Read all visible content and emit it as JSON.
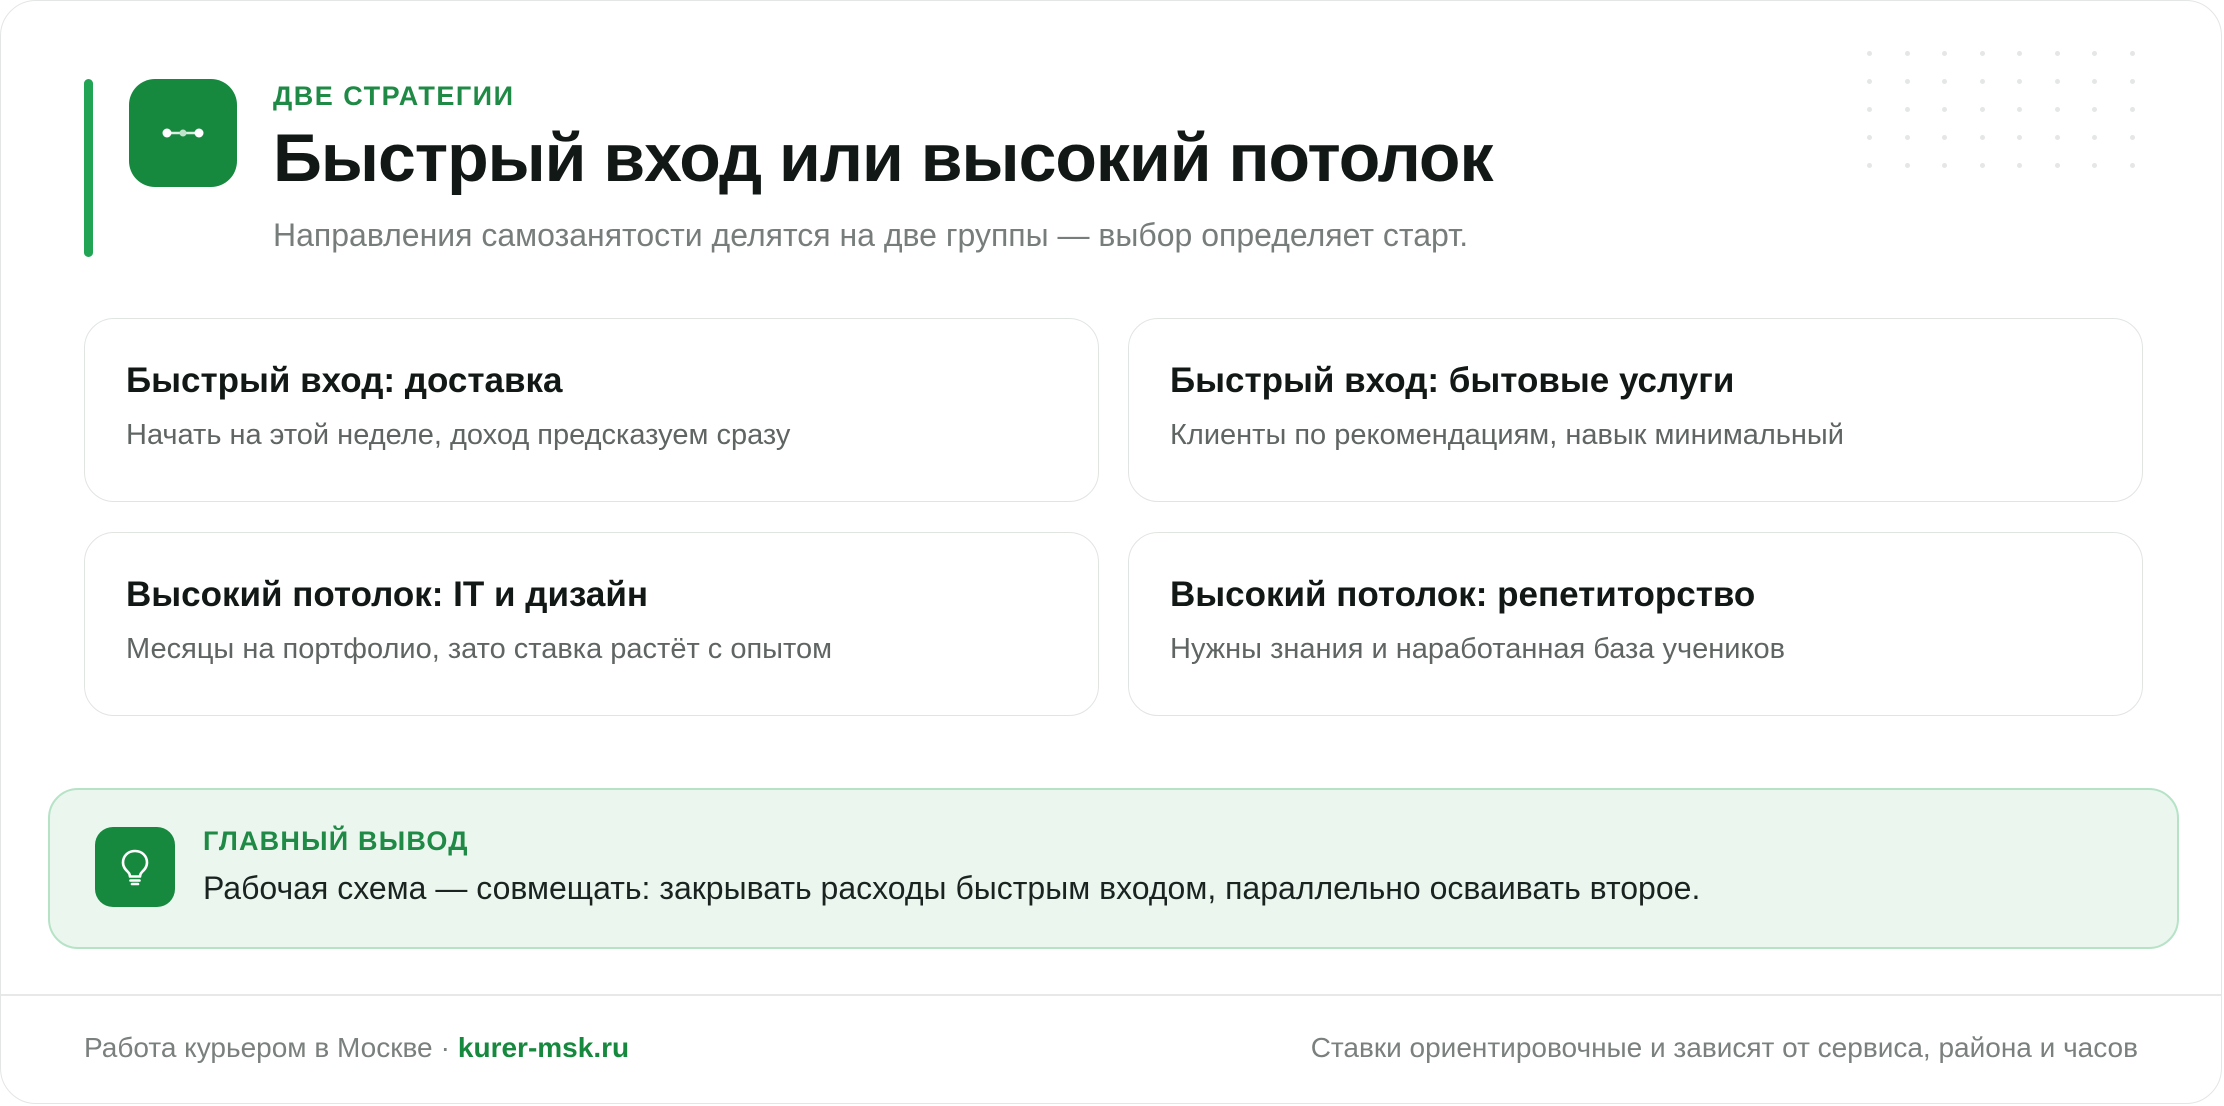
{
  "colors": {
    "brand_green": "#17893f",
    "accent_green": "#22a455",
    "callout_bg": "#ebf6ef"
  },
  "header": {
    "logo_icon": "route-dots-icon",
    "eyebrow": "ДВЕ СТРАТЕГИИ",
    "title": "Быстрый вход или высокий потолок",
    "subtitle": "Направления самозанятости делятся на две группы — выбор определяет старт."
  },
  "cards": [
    {
      "title": "Быстрый вход: доставка",
      "text": "Начать на этой неделе, доход предсказуем сразу"
    },
    {
      "title": "Быстрый вход: бытовые услуги",
      "text": "Клиенты по рекомендациям, навык минимальный"
    },
    {
      "title": "Высокий потолок: IT и дизайн",
      "text": "Месяцы на портфолио, зато ставка растёт с опытом"
    },
    {
      "title": "Высокий потолок: репетиторство",
      "text": "Нужны знания и наработанная база учеников"
    }
  ],
  "callout": {
    "icon": "lightbulb-icon",
    "label": "ГЛАВНЫЙ ВЫВОД",
    "text": "Рабочая схема — совмещать: закрывать расходы быстрым входом, параллельно осваивать второе."
  },
  "footer": {
    "left_text": "Работа курьером в Москве",
    "separator": "·",
    "brand": "kurer-msk.ru",
    "right_text": "Ставки ориентировочные и зависят от сервиса, района и часов"
  }
}
